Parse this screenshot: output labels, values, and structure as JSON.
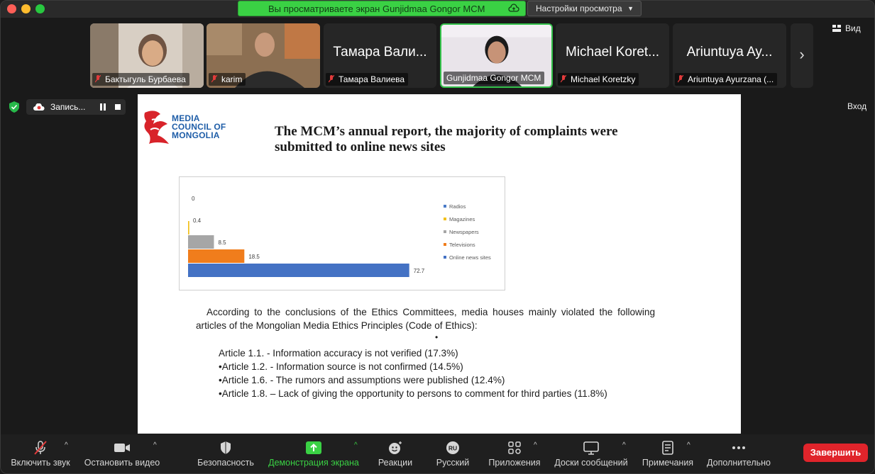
{
  "window": {
    "share_banner": "Вы просматриваете экран Gunjidmaa Gongor MCM",
    "view_options": "Настройки просмотра"
  },
  "participants": [
    {
      "name": "Бактыгуль Бурбаева",
      "video": true,
      "muted": true
    },
    {
      "name": "karim",
      "video": true,
      "muted": true
    },
    {
      "name": "Тамара Валиева",
      "display": "Тамара Вали...",
      "video": false,
      "muted": true
    },
    {
      "name": "Gunjidmaa Gongor MCM",
      "video": true,
      "muted": false,
      "active": true
    },
    {
      "name": "Michael Koretzky",
      "display": "Michael Koret...",
      "video": false,
      "muted": true
    },
    {
      "name": "Ariuntuya Ayurzana (...",
      "display": "Ariuntuya Ay...",
      "video": false,
      "muted": true
    }
  ],
  "top_right": {
    "view_label": "Вид",
    "enter_label": "Вход"
  },
  "recording": {
    "label": "Запись..."
  },
  "slide": {
    "logo_lines": [
      "MEDIA",
      "COUNCIL OF",
      "MONGOLIA"
    ],
    "title": "The MCM’s annual report, the majority of complaints were submitted to online news sites",
    "paragraph": "According to the conclusions of the Ethics Committees, media houses mainly violated the following articles of the Mongolian Media Ethics Principles (Code of Ethics):",
    "bullet": "•",
    "articles": [
      "Article 1.1. - Information accuracy is not verified (17.3%)",
      "•Article 1.2. - Information source is not confirmed (14.5%)",
      "•Article 1.6. - The rumors and assumptions were published (12.4%)",
      "•Article 1.8. – Lack of giving the opportunity to persons to comment for third parties (11.8%)"
    ]
  },
  "chart_data": {
    "type": "bar",
    "orientation": "horizontal",
    "categories": [
      "Radios",
      "Magazines",
      "Newspapers",
      "Televisions",
      "Online news sites"
    ],
    "values": [
      0,
      0.4,
      8.5,
      18.5,
      72.7
    ],
    "value_labels": [
      "0",
      "0.4",
      "8.5",
      "18.5",
      "72.7"
    ],
    "colors": [
      "#4a7bc8",
      "#f2c01c",
      "#a6a6a6",
      "#f07d1c",
      "#4472c4"
    ],
    "legend": [
      "Radios",
      "Magazines",
      "Newspapers",
      "Televisions",
      "Online news sites"
    ],
    "legend_position": "right",
    "xlim": [
      0,
      80
    ],
    "grid": false
  },
  "toolbar": {
    "items": [
      {
        "label": "Включить звук",
        "icon": "mic-muted-icon"
      },
      {
        "label": "Остановить видео",
        "icon": "video-camera-icon"
      },
      {
        "label": "Безопасность",
        "icon": "shield-icon"
      },
      {
        "label": "Демонстрация экрана",
        "icon": "share-screen-icon"
      },
      {
        "label": "Реакции",
        "icon": "emoji-icon"
      },
      {
        "label": "Русский",
        "icon": "language-ru-icon",
        "badge": "RU"
      },
      {
        "label": "Приложения",
        "icon": "apps-icon"
      },
      {
        "label": "Доски сообщений",
        "icon": "whiteboard-icon"
      },
      {
        "label": "Примечания",
        "icon": "notes-icon"
      },
      {
        "label": "Дополнительно",
        "icon": "more-icon"
      }
    ],
    "end_label": "Завершить"
  },
  "colors": {
    "accent_green": "#3ad144",
    "end_red": "#e0242b",
    "slide_logo_blue": "#1f5ea8"
  }
}
